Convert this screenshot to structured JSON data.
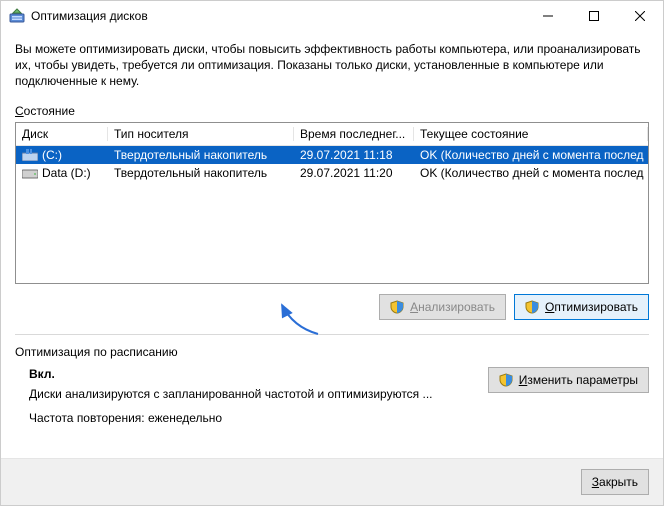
{
  "window": {
    "title": "Оптимизация дисков"
  },
  "description": "Вы можете оптимизировать диски, чтобы повысить эффективность работы  компьютера, или проанализировать их, чтобы увидеть, требуется ли оптимизация. Показаны только диски, установленные в компьютере или подключенные к нему.",
  "state_label_pre": "С",
  "state_label_rest": "остояние",
  "columns": {
    "disk": "Диск",
    "type": "Тип носителя",
    "time": "Время последнег...",
    "state": "Текущее состояние"
  },
  "rows": [
    {
      "name": "(C:)",
      "type": "Твердотельный накопитель",
      "time": "29.07.2021 11:18",
      "state": "OK (Количество дней с момента послед",
      "selected": true,
      "icon": "system"
    },
    {
      "name": "Data (D:)",
      "type": "Твердотельный накопитель",
      "time": "29.07.2021 11:20",
      "state": "OK (Количество дней с момента послед",
      "selected": false,
      "icon": "data"
    }
  ],
  "buttons": {
    "analyze_pre": "А",
    "analyze_rest": "нализировать",
    "optimize_pre": "О",
    "optimize_rest": "птимизировать",
    "change_pre": "И",
    "change_rest": "зменить параметры",
    "close_pre": "З",
    "close_rest": "акрыть"
  },
  "schedule": {
    "heading": "Оптимизация по расписанию",
    "on": "Вкл.",
    "line1": "Диски анализируются с запланированной частотой и оптимизируются ...",
    "line2": "Частота повторения: еженедельно"
  }
}
